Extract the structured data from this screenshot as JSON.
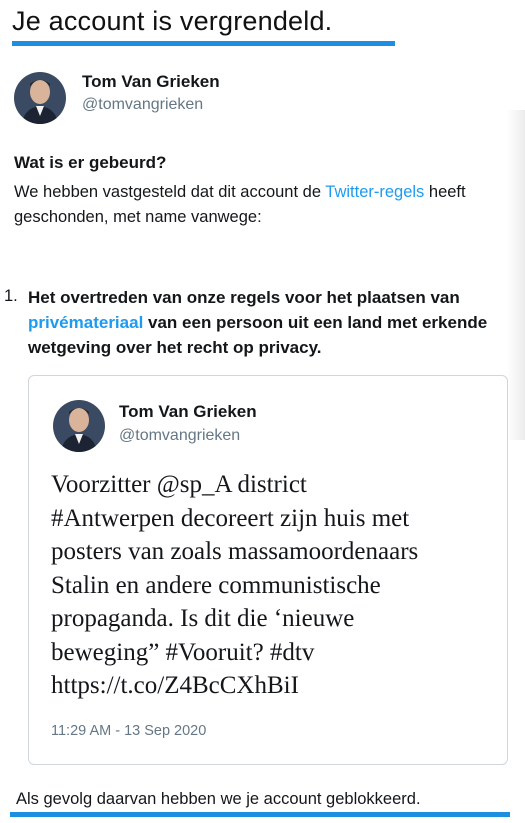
{
  "page": {
    "title": "Je account is vergrendeld."
  },
  "account": {
    "name": "Tom Van Grieken",
    "handle": "@tomvangrieken"
  },
  "notice": {
    "heading": "Wat is er gebeurd?",
    "intro_before": "We hebben vastgesteld dat dit account de ",
    "intro_link": "Twitter-regels",
    "intro_after": " heeft geschonden, met name vanwege:"
  },
  "violation": {
    "number": "1.",
    "text_before": "Het overtreden van onze regels voor het plaatsen van ",
    "text_link": "privémateriaal",
    "text_after": " van een persoon uit een land met erkende wetgeving over het recht op privacy."
  },
  "tweet": {
    "author_name": "Tom Van Grieken",
    "author_handle": "@tomvangrieken",
    "lines": [
      "Voorzitter @sp_A district",
      "#Antwerpen decoreert zijn huis met",
      "posters van zoals massamoordenaars",
      "Stalin en andere communistische",
      "propaganda. Is dit die ‘nieuwe",
      "beweging” #Vooruit? #dtv",
      "https://t.co/Z4BcCXhBiI"
    ],
    "timestamp": "11:29 AM - 13 Sep 2020"
  },
  "footer": {
    "text": "Als gevolg daarvan hebben we je account geblokkeerd."
  },
  "colors": {
    "accent_underline": "#1d8fe1",
    "link": "#1d9bf0",
    "secondary_text": "#657786",
    "card_border": "#cfd6dc"
  },
  "icons": {
    "avatar": "profile-photo"
  }
}
